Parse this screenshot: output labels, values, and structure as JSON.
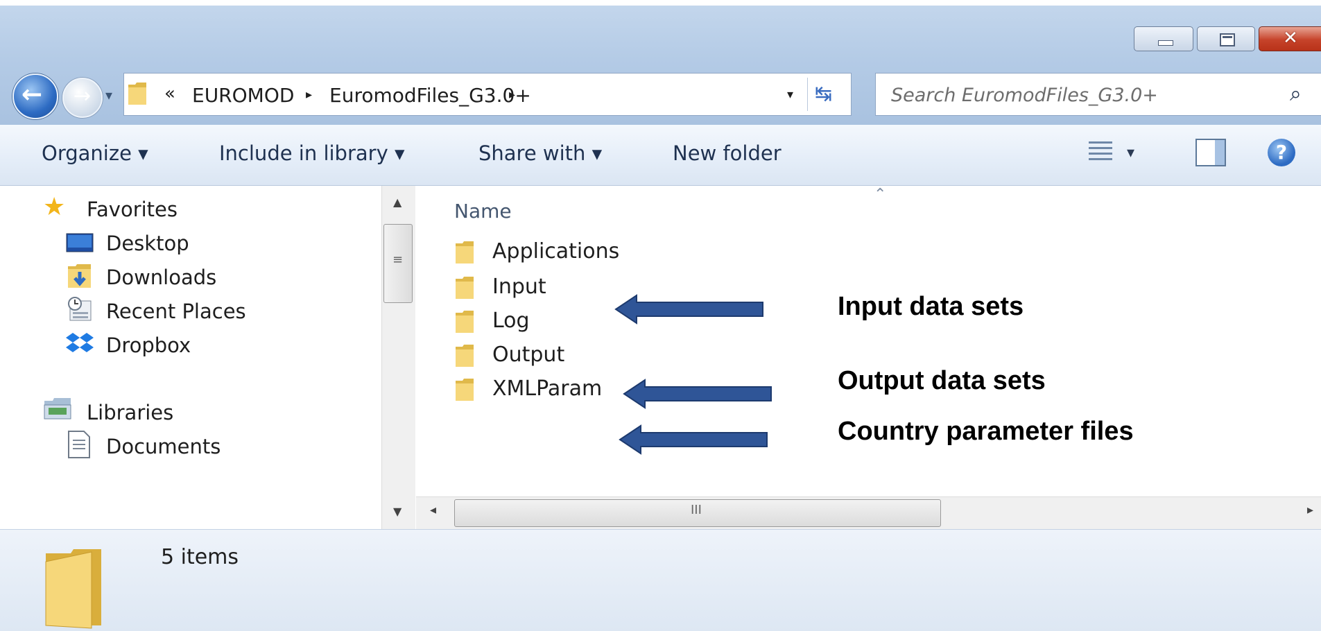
{
  "window": {
    "caption_buttons": {
      "minimize_icon": "minimize-icon",
      "maximize_icon": "maximize-icon",
      "close_icon": "close-icon"
    }
  },
  "nav": {
    "back_icon": "back-arrow-icon",
    "forward_icon": "forward-arrow-icon",
    "history_dropdown_icon": "chevron-down-icon"
  },
  "address": {
    "overflow_glyph": "«",
    "breadcrumbs": [
      "EUROMOD",
      "EuromodFiles_G3.0+"
    ],
    "separator_glyph": "▸",
    "dropdown_glyph": "▾",
    "refresh_glyph": "↹"
  },
  "search": {
    "placeholder": "Search EuromodFiles_G3.0+",
    "icon": "search-icon"
  },
  "toolbar": {
    "organize": "Organize ▾",
    "include_in_library": "Include in library ▾",
    "share_with": "Share with ▾",
    "new_folder": "New folder",
    "help_glyph": "?"
  },
  "navpane": {
    "favorites_header": "Favorites",
    "favorites": [
      "Desktop",
      "Downloads",
      "Recent Places",
      "Dropbox"
    ],
    "libraries_header": "Libraries",
    "libraries": [
      "Documents"
    ]
  },
  "content": {
    "column_name": "Name",
    "items": [
      "Applications",
      "Input",
      "Log",
      "Output",
      "XMLParam"
    ]
  },
  "details": {
    "item_count": "5 items"
  },
  "annotations": {
    "input": "Input data sets",
    "output": "Output data sets",
    "param": "Country parameter files",
    "arrow_color": "#2f5597"
  },
  "colors": {
    "chrome": "#b4cbe6",
    "toolbar": "#e4edf8",
    "folder": "#f4d572"
  }
}
